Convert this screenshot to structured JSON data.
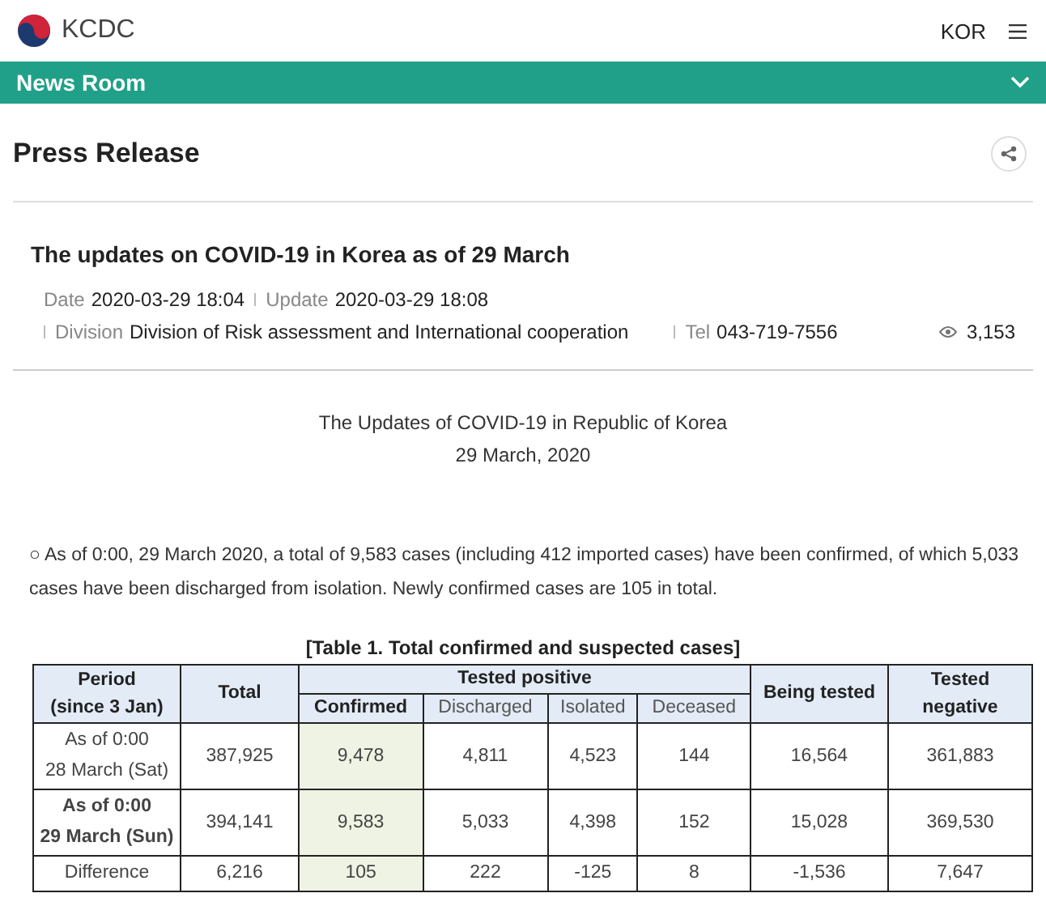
{
  "header": {
    "logo": "KCDC",
    "language": "KOR"
  },
  "nav_bar": {
    "title": "News Room"
  },
  "page": {
    "title": "Press Release"
  },
  "article": {
    "title": "The updates on COVID-19 in Korea as of 29 March",
    "meta": [
      {
        "label": "Date",
        "value": "2020-03-29 18:04"
      },
      {
        "label": "Update",
        "value": "2020-03-29 18:08"
      }
    ],
    "meta_2": [
      {
        "label": "Division",
        "value": "Division of Risk assessment and International cooperation"
      },
      {
        "label": "Tel",
        "value": "043-719-7556"
      }
    ],
    "views": "3,153",
    "heading": [
      "The Updates of COVID-19 in Republic of Korea",
      "29 March, 2020"
    ],
    "paragraph": "○ As of 0:00, 29 March 2020, a total of 9,583 cases (including 412 imported cases) have been confirmed, of which 5,033 cases have been discharged from isolation. Newly confirmed cases are 105 in total.",
    "table": {
      "caption": "[Table 1. Total confirmed and suspected cases]",
      "header_1": [
        "Period\n(since 3 Jan)",
        "Total",
        "Tested positive",
        "Being tested",
        "Tested\nnegative"
      ],
      "header_2": [
        "Confirmed",
        "Discharged",
        "Isolated",
        "Deceased"
      ],
      "rows": [
        {
          "period": "As of 0:00\n28 March (Sat)",
          "bold": false,
          "cells": [
            "387,925",
            "9,478",
            "4,811",
            "4,523",
            "144",
            "16,564",
            "361,883"
          ]
        },
        {
          "period": "As of 0:00\n29 March (Sun)",
          "bold": true,
          "cells": [
            "394,141",
            "9,583",
            "5,033",
            "4,398",
            "152",
            "15,028",
            "369,530"
          ]
        },
        {
          "period": "Difference",
          "bold": false,
          "cells": [
            "6,216",
            "105",
            "222",
            "-125",
            "8",
            "-1,536",
            "7,647"
          ]
        }
      ]
    }
  }
}
